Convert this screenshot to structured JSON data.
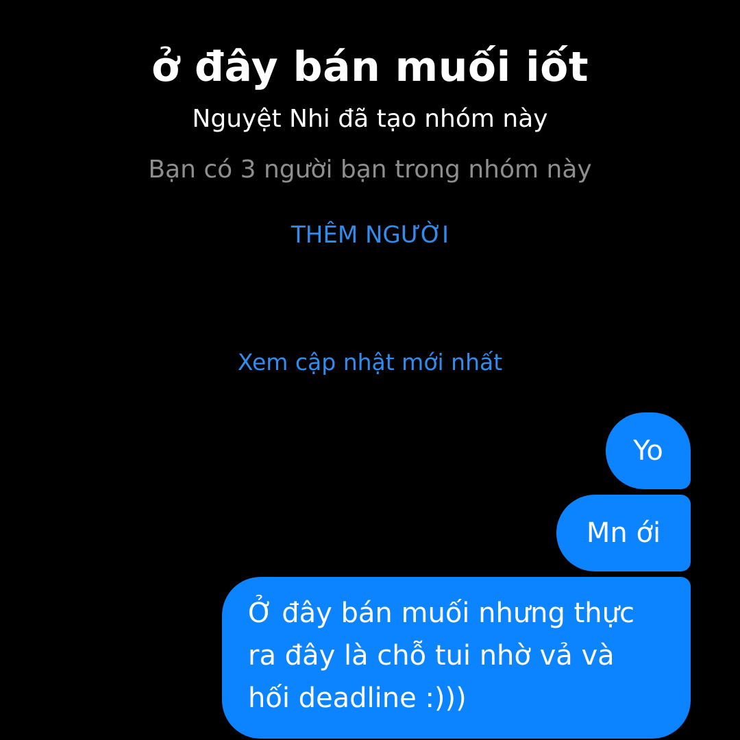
{
  "group": {
    "title": "ở đây bán muối iốt",
    "creator_text": "Nguyệt Nhi đã tạo nhóm này",
    "friends_text": "Bạn có 3 người bạn trong nhóm này",
    "add_people_label": "THÊM NGƯỜI"
  },
  "latest_updates_label": "Xem cập nhật mới nhất",
  "messages": [
    {
      "text": "Yo"
    },
    {
      "text": "Mn ới"
    },
    {
      "text": "Ở đây bán muối nhưng thực ra đây là chỗ tui nhờ vả và hối deadline :)))"
    }
  ],
  "colors": {
    "background": "#000000",
    "accent": "#2f8df0",
    "bubble": "#0d84ff",
    "muted_text": "#8e8e8e"
  }
}
